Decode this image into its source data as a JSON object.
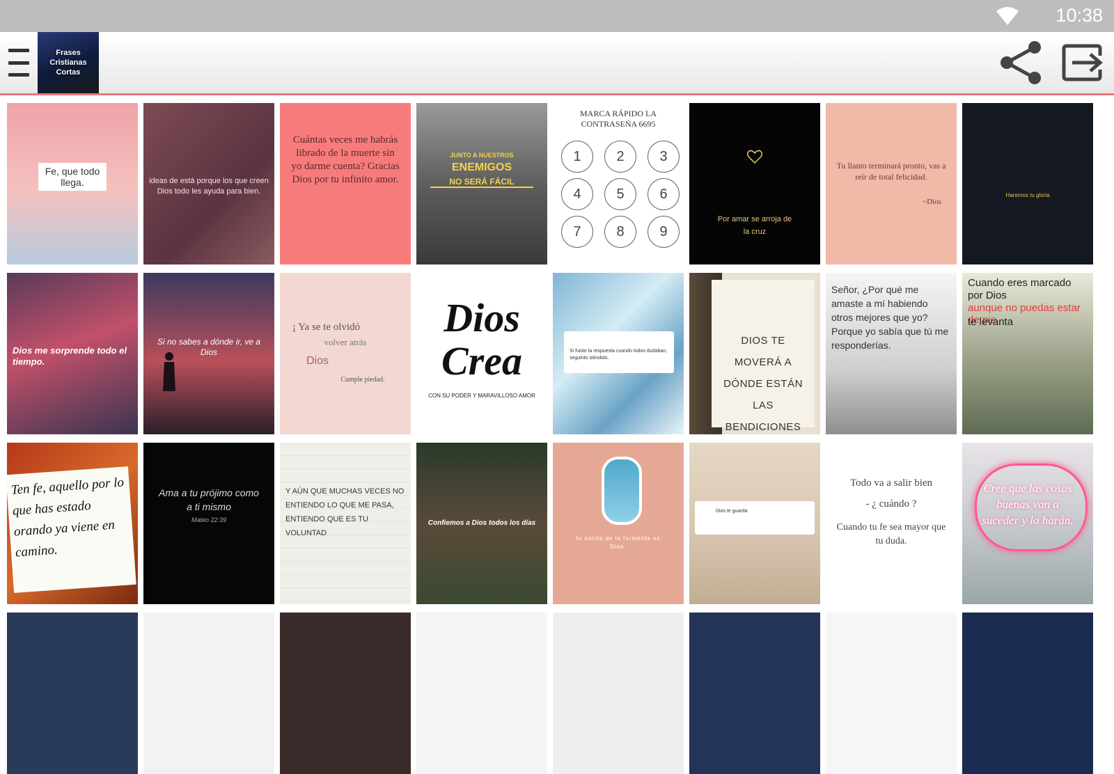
{
  "status": {
    "time": "10:38"
  },
  "app": {
    "logo_text": "Frases Cristianas Cortas",
    "menu_icon": "hamburger-icon",
    "share_icon": "share-icon",
    "exit_icon": "exit-icon"
  },
  "colors": {
    "accent_line": "#f07777",
    "status_bar": "#bdbdbd"
  },
  "tiles": [
    {
      "text": "Fe, que todo llega."
    },
    {
      "text": "ideas de está porque los que creen Dios todo les ayuda para bien."
    },
    {
      "text": "Cuántas veces me habrás librado de la muerte sin yo darme cuenta? Gracias Dios por tu infinito amor."
    },
    {
      "line1": "JUNTO A NUESTROS",
      "line2": "ENEMIGOS",
      "line3": "NO SERÁ FÁCIL"
    },
    {
      "title": "MARCA RÁPIDO LA CONTRASEÑA 6695",
      "keys": [
        "1",
        "2",
        "3",
        "4",
        "5",
        "6",
        "7",
        "8",
        "9"
      ]
    },
    {
      "text": "Por amar se arroja de la cruz"
    },
    {
      "text": "Tu llanto terminará pronto, vas a reír de total felicidad.",
      "sign": "~Dios"
    },
    {
      "text": "Haremos tu gloria"
    },
    {
      "text": "Dios me sorprende todo el tiempo."
    },
    {
      "text": "Si no sabes a dónde ir, ve a Dios"
    },
    {
      "line1": "¡ Ya se te olvidó",
      "line2": "volver atrás",
      "line3": "Dios",
      "line4": "Cumple piedad."
    },
    {
      "line1": "Dios",
      "line2": "Crea",
      "line3": "CON SU PODER Y MARAVILLOSO AMOR"
    },
    {
      "text": "Si fuiste la respuesta cuando todos dudaban, seguirás siéndolo."
    },
    {
      "text": "DIOS TE MOVERÁ A DÓNDE ESTÁN LAS BENDICIONES QUE TÚ NECESITAS."
    },
    {
      "text": "Señor, ¿Por qué me amaste a mí habiendo otros mejores que yo? Porque yo sabía que tú me responderías."
    },
    {
      "line1": "Cuando eres marcado por Dios",
      "line2": "aunque no puedas estar de pie",
      "line3": "te levanta"
    },
    {
      "text": "Ten fe, aquello por lo que has estado orando ya viene en camino."
    },
    {
      "text": "Ama a tu prójimo como a ti mismo",
      "ref": "Mateo 22:39"
    },
    {
      "text": "Y AÚN QUE MUCHAS VECES NO ENTIENDO LO QUE ME PASA, ENTIENDO QUE ES TU VOLUNTAD"
    },
    {
      "text": "Confiemos a Dios todos los días"
    },
    {
      "text": "tu salida de la tormenta es Dios."
    },
    {
      "text": "Dios te guarda"
    },
    {
      "line1": "Todo va a salir bien",
      "line2": "- ¿ cuándo ?",
      "line3": "Cuando tu fe sea mayor que tu duda."
    },
    {
      "text": "Cree que las cosas buenas van a suceder y lo harán."
    }
  ]
}
